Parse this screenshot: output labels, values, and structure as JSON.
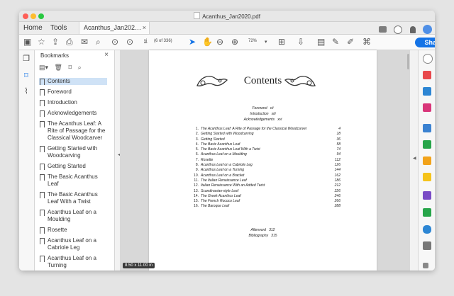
{
  "window": {
    "title": "Acanthus_Jan2020.pdf"
  },
  "tabs": {
    "home": "Home",
    "tools": "Tools",
    "document": "Acanthus_Jan202…",
    "close": "×"
  },
  "toolbar": {
    "page_current": "vi",
    "page_info": "(6 of 336)",
    "zoom": "72%",
    "share": "Share"
  },
  "bookmarks": {
    "title": "Bookmarks",
    "close": "×",
    "items": [
      "Contents",
      "Foreword",
      "Introduction",
      "Acknowledgements",
      "The Acanthus Leaf: A Rite of Passage for the Classical Woodcarver",
      "Getting Started with Woodcarving",
      "Getting Started",
      "The Basic Acanthus Leaf",
      "The Basic Acanthus Leaf With a Twist",
      "Acanthus Leaf on a Moulding",
      "Rosette",
      "Acanthus Leaf on a Cabriole Leg",
      "Acanthus Leaf on a Turning"
    ]
  },
  "page": {
    "title": "Contents",
    "front": [
      {
        "label": "Foreword",
        "page": "vii"
      },
      {
        "label": "Introduction",
        "page": "xiii"
      },
      {
        "label": "Acknowledgements",
        "page": "xvi"
      }
    ],
    "toc": [
      {
        "n": "1.",
        "title": "The Acanthus Leaf: A Rite of Passage for the Classical Woodcarver",
        "page": "4"
      },
      {
        "n": "2.",
        "title": "Getting Started with Woodcarving",
        "page": "18"
      },
      {
        "n": "3.",
        "title": "Getting Started",
        "page": "36"
      },
      {
        "n": "4.",
        "title": "The Basic Acanthus Leaf",
        "page": "58"
      },
      {
        "n": "5.",
        "title": "The Basic Acanthus Leaf With a Twist",
        "page": "74"
      },
      {
        "n": "6.",
        "title": "Acanthus Leaf on a Moulding",
        "page": "94"
      },
      {
        "n": "7.",
        "title": "Rosette",
        "page": "112"
      },
      {
        "n": "8.",
        "title": "Acanthus Leaf on a Cabriole Leg",
        "page": "126"
      },
      {
        "n": "9.",
        "title": "Acanthus Leaf on a Turning",
        "page": "144"
      },
      {
        "n": "10.",
        "title": "Acanthus Leaf on a Bracket",
        "page": "162"
      },
      {
        "n": "11.",
        "title": "The Italian Renaissance Leaf",
        "page": "186"
      },
      {
        "n": "12.",
        "title": "Italian Renaissance With an Added Twist",
        "page": "212"
      },
      {
        "n": "13.",
        "title": "Scandinavian-style Leaf",
        "page": "226"
      },
      {
        "n": "14.",
        "title": "The Greek Acanthus Leaf",
        "page": "246"
      },
      {
        "n": "15.",
        "title": "The French Rococo Leaf",
        "page": "266"
      },
      {
        "n": "16.",
        "title": "The Baroque Leaf",
        "page": "288"
      }
    ],
    "back": [
      {
        "label": "Afterword",
        "page": "312"
      },
      {
        "label": "Bibliography",
        "page": "315"
      }
    ],
    "size": "8.50 x 11.00 in"
  }
}
